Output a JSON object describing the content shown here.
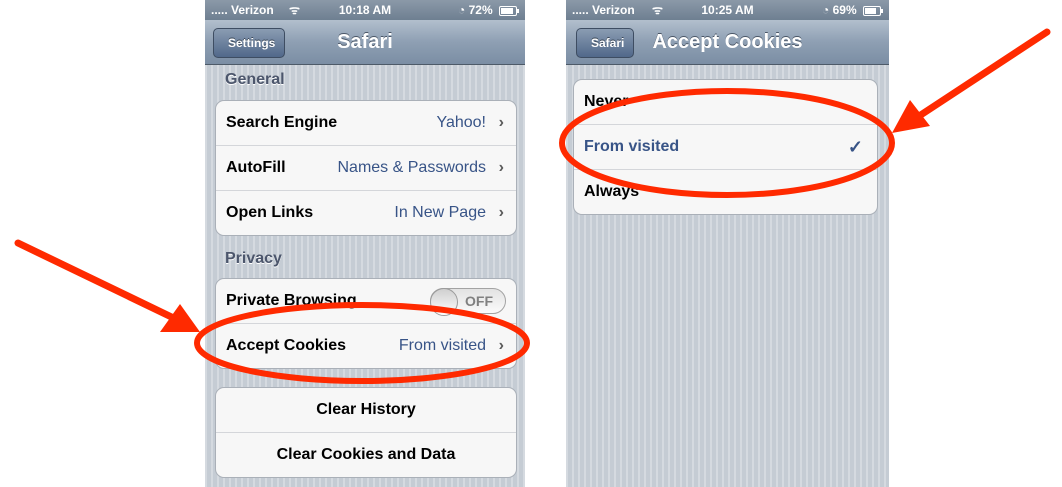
{
  "left_phone": {
    "status": {
      "carrier": "..... Verizon",
      "time": "10:18 AM",
      "battery": "72%",
      "battery_level": 0.72
    },
    "nav": {
      "back": "Settings",
      "title": "Safari"
    },
    "general": {
      "header": "General",
      "rows": [
        {
          "label": "Search Engine",
          "value": "Yahoo!"
        },
        {
          "label": "AutoFill",
          "value": "Names & Passwords"
        },
        {
          "label": "Open Links",
          "value": "In New Page"
        }
      ]
    },
    "privacy": {
      "header": "Privacy",
      "private_browsing": {
        "label": "Private Browsing",
        "toggle": "OFF"
      },
      "accept_cookies": {
        "label": "Accept Cookies",
        "value": "From visited"
      }
    },
    "actions": {
      "clear_history": "Clear History",
      "clear_cookies": "Clear Cookies and Data"
    }
  },
  "right_phone": {
    "status": {
      "carrier": "..... Verizon",
      "time": "10:25 AM",
      "battery": "69%",
      "battery_level": 0.69
    },
    "nav": {
      "back": "Safari",
      "title": "Accept Cookies"
    },
    "options": [
      {
        "label": "Never",
        "selected": false
      },
      {
        "label": "From visited",
        "selected": true
      },
      {
        "label": "Always",
        "selected": false
      }
    ],
    "checkmark": "✓"
  },
  "chevron": "›",
  "wifi_icon": "ᯤ",
  "alarm_icon": "◔",
  "colors": {
    "annotation": "#ff2a00",
    "value_blue": "#385487"
  }
}
